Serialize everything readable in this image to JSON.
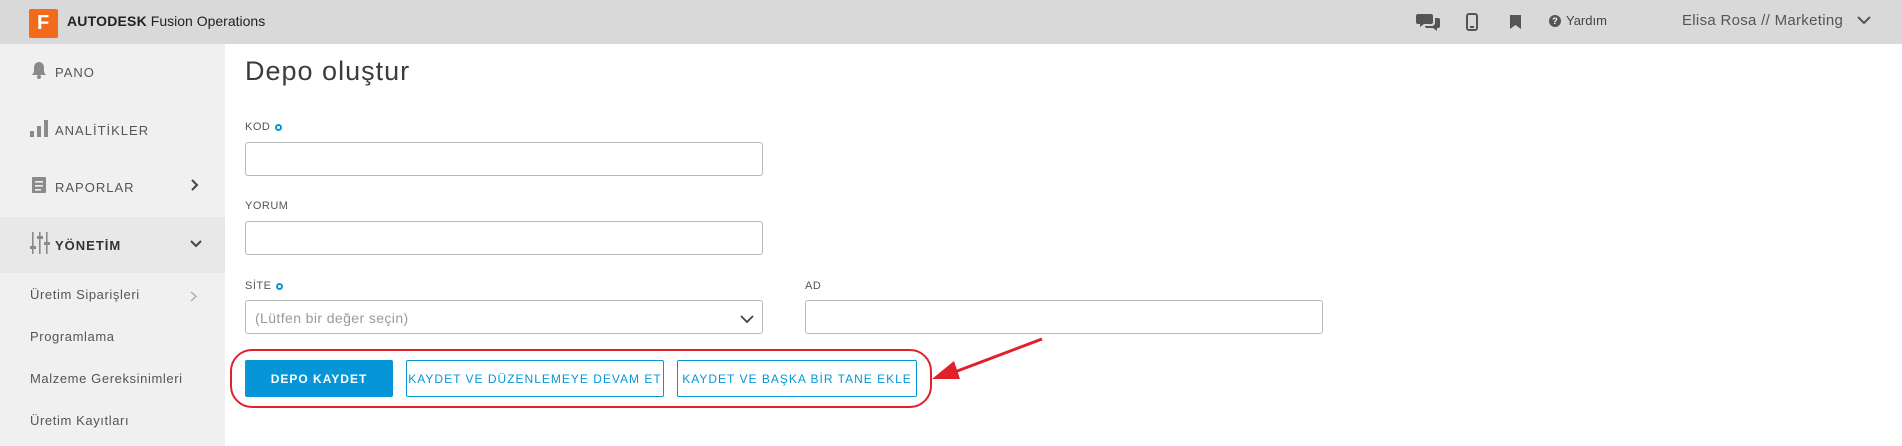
{
  "header": {
    "brand_bold": "AUTODESK",
    "brand_rest": " Fusion Operations",
    "logo_letter": "F",
    "help_label": "Yardım",
    "user": "Elisa Rosa // Marketing",
    "icons": [
      "chat-icon",
      "mobile-icon",
      "bookmark-icon",
      "help-icon",
      "chevron-down-icon"
    ]
  },
  "sidebar": {
    "items": [
      {
        "label": "PANO",
        "icon": "bell-icon"
      },
      {
        "label": "ANALİTİKLER",
        "icon": "bar-chart-icon"
      },
      {
        "label": "RAPORLAR",
        "icon": "report-icon"
      },
      {
        "label": "YÖNETİM",
        "icon": "sliders-icon"
      }
    ],
    "subitems": [
      {
        "label": "Üretim Siparişleri"
      },
      {
        "label": "Programlama"
      },
      {
        "label": "Malzeme Gereksinimleri"
      },
      {
        "label": "Üretim Kayıtları"
      }
    ]
  },
  "page": {
    "title": "Depo oluştur"
  },
  "form": {
    "kod_label": "KOD",
    "yorum_label": "YORUM",
    "site_label": "SİTE",
    "site_placeholder": "(Lütfen bir değer seçin)",
    "ad_label": "AD",
    "kod_value": "",
    "yorum_value": "",
    "ad_value": ""
  },
  "actions": {
    "save": "DEPO KAYDET",
    "save_continue": "KAYDET VE DÜZENLEMEYE DEVAM ET",
    "save_add_another": "KAYDET VE BAŞKA BİR TANE EKLE"
  },
  "colors": {
    "accent": "#0696d7",
    "brand": "#f26b1d",
    "annotation": "#e0202a",
    "topbar": "#d9d9d9",
    "sidebar": "#f0f0f0"
  }
}
